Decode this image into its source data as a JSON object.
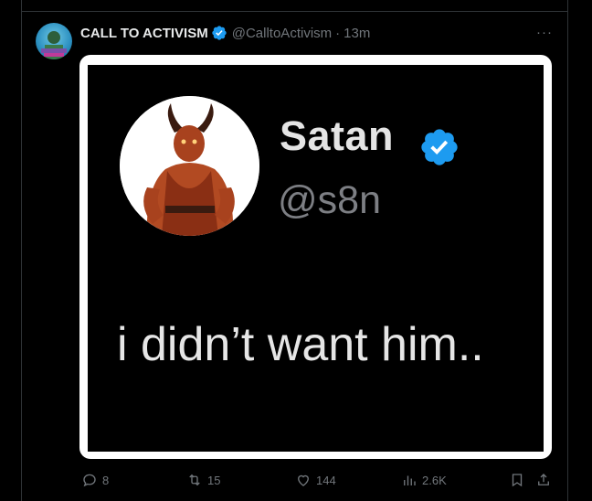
{
  "tweet": {
    "display_name": "CALL TO ACTIVISM",
    "handle": "@CalltoActivism",
    "separator": "·",
    "time": "13m",
    "more_icon": "more-horizontal-icon",
    "more_label": "···"
  },
  "embedded_post": {
    "name": "Satan",
    "handle": "@s8n",
    "text": "i didn’t want him.."
  },
  "actions": {
    "replies": "8",
    "reposts": "15",
    "likes": "144",
    "views": "2.6K"
  },
  "colors": {
    "background": "#000000",
    "verified_blue": "#1d9bf0",
    "muted_text": "#71767b",
    "primary_text": "#e7e9ea"
  }
}
